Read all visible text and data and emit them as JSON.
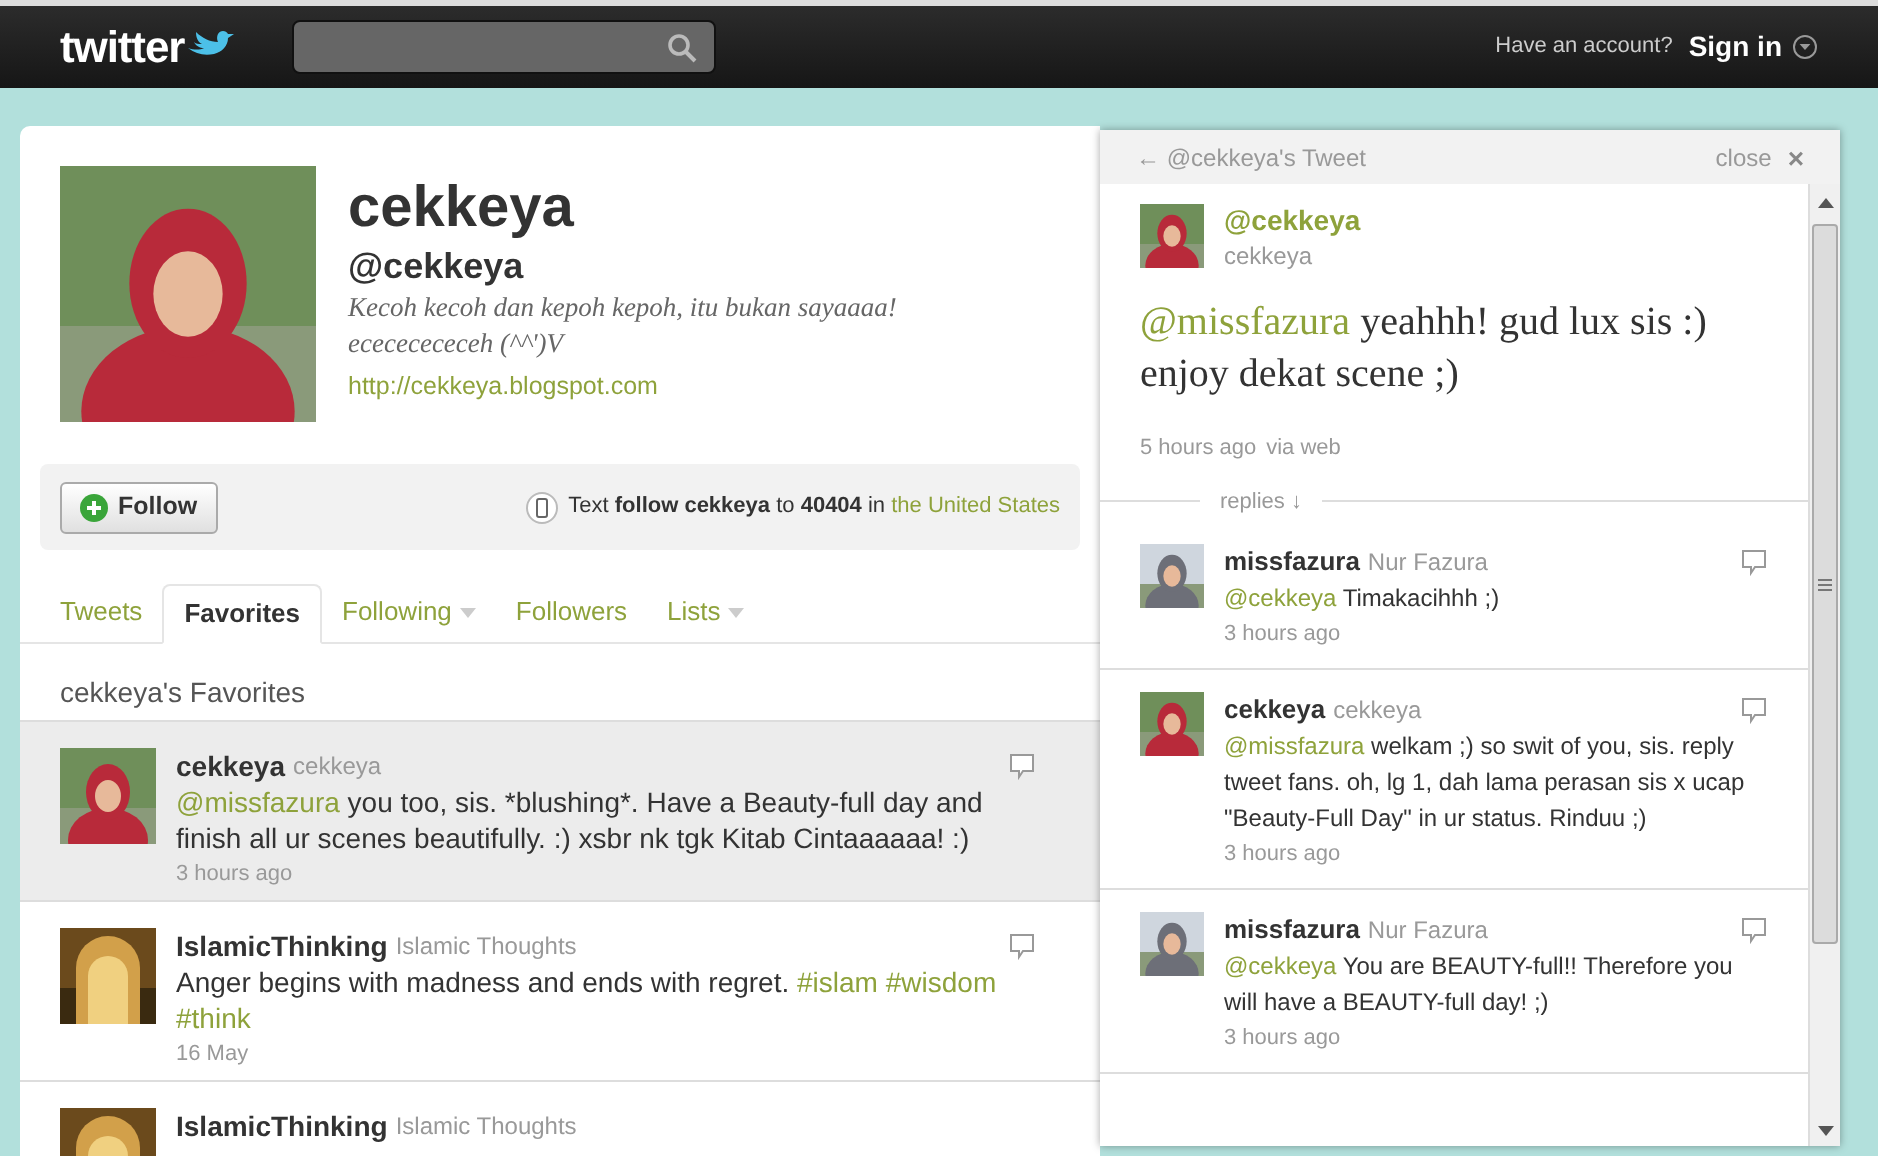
{
  "topbar": {
    "logo": "twitter",
    "account_prompt": "Have an account?",
    "sign_in": "Sign in"
  },
  "profile": {
    "name": "cekkeya",
    "handle": "@cekkeya",
    "bio": "Kecoh kecoh dan kepoh kepoh, itu bukan sayaaaa! ecececececeh (^^')V",
    "url": "http://cekkeya.blogspot.com"
  },
  "follow_bar": {
    "button": "Follow",
    "sms": "Text **follow cekkeya** to **40404** in",
    "sms_link": "the United States"
  },
  "tabs": [
    {
      "label": "Tweets",
      "selected": false,
      "menu": false
    },
    {
      "label": "Favorites",
      "selected": true,
      "menu": false
    },
    {
      "label": "Following",
      "selected": false,
      "menu": true
    },
    {
      "label": "Followers",
      "selected": false,
      "menu": false
    },
    {
      "label": "Lists",
      "selected": false,
      "menu": true
    }
  ],
  "favorites": {
    "title": "cekkeya's Favorites",
    "items": [
      {
        "name": "cekkeya",
        "fullname": "cekkeya",
        "selected": true,
        "segments": [
          {
            "kind": "link",
            "text": "@missfazura"
          },
          {
            "kind": "text",
            "text": " you too, sis. *blushing*. Have a Beauty-full day and finish all ur scenes beautifully. :) xsbr nk tgk Kitab Cintaaaaaa! :)"
          }
        ],
        "time": "3 hours ago"
      },
      {
        "name": "IslamicThinking",
        "fullname": "Islamic Thoughts",
        "selected": false,
        "segments": [
          {
            "kind": "text",
            "text": "Anger begins with madness and ends with regret. "
          },
          {
            "kind": "link",
            "text": "#islam"
          },
          {
            "kind": "link",
            "text": "#wisdom"
          },
          {
            "kind": "link",
            "text": "#think"
          }
        ],
        "time": "16 May"
      },
      {
        "name": "IslamicThinking",
        "fullname": "Islamic Thoughts",
        "selected": false
      }
    ]
  },
  "detail": {
    "back": "← @cekkeya's Tweet",
    "close": "close",
    "close_icon": "×",
    "handle": "@cekkeya",
    "fullname": "cekkeya",
    "segments": [
      {
        "kind": "link",
        "text": "@missfazura"
      },
      {
        "kind": "text",
        "text": " yeahhh! gud lux sis :) enjoy dekat scene ;)"
      }
    ],
    "time": "5 hours ago",
    "source": "via web",
    "replies_label": "replies ↓",
    "replies": [
      {
        "name": "missfazura",
        "fullname": "Nur Fazura",
        "segments": [
          {
            "kind": "link",
            "text": "@cekkeya"
          },
          {
            "kind": "text",
            "text": " Timakacihhh ;)"
          }
        ],
        "time": "3 hours ago"
      },
      {
        "name": "cekkeya",
        "fullname": "cekkeya",
        "segments": [
          {
            "kind": "link",
            "text": "@missfazura"
          },
          {
            "kind": "text",
            "text": " welkam ;) so swit of you, sis. reply tweet fans. oh, lg 1, dah lama perasan sis x ucap \"Beauty-Full Day\" in ur status. Rinduu ;)"
          }
        ],
        "time": "3 hours ago"
      },
      {
        "name": "missfazura",
        "fullname": "Nur Fazura",
        "segments": [
          {
            "kind": "link",
            "text": "@cekkeya"
          },
          {
            "kind": "text",
            "text": " You are BEAUTY-full!! Therefore you will have a BEAUTY-full day! ;)"
          }
        ],
        "time": "3 hours ago"
      }
    ]
  }
}
